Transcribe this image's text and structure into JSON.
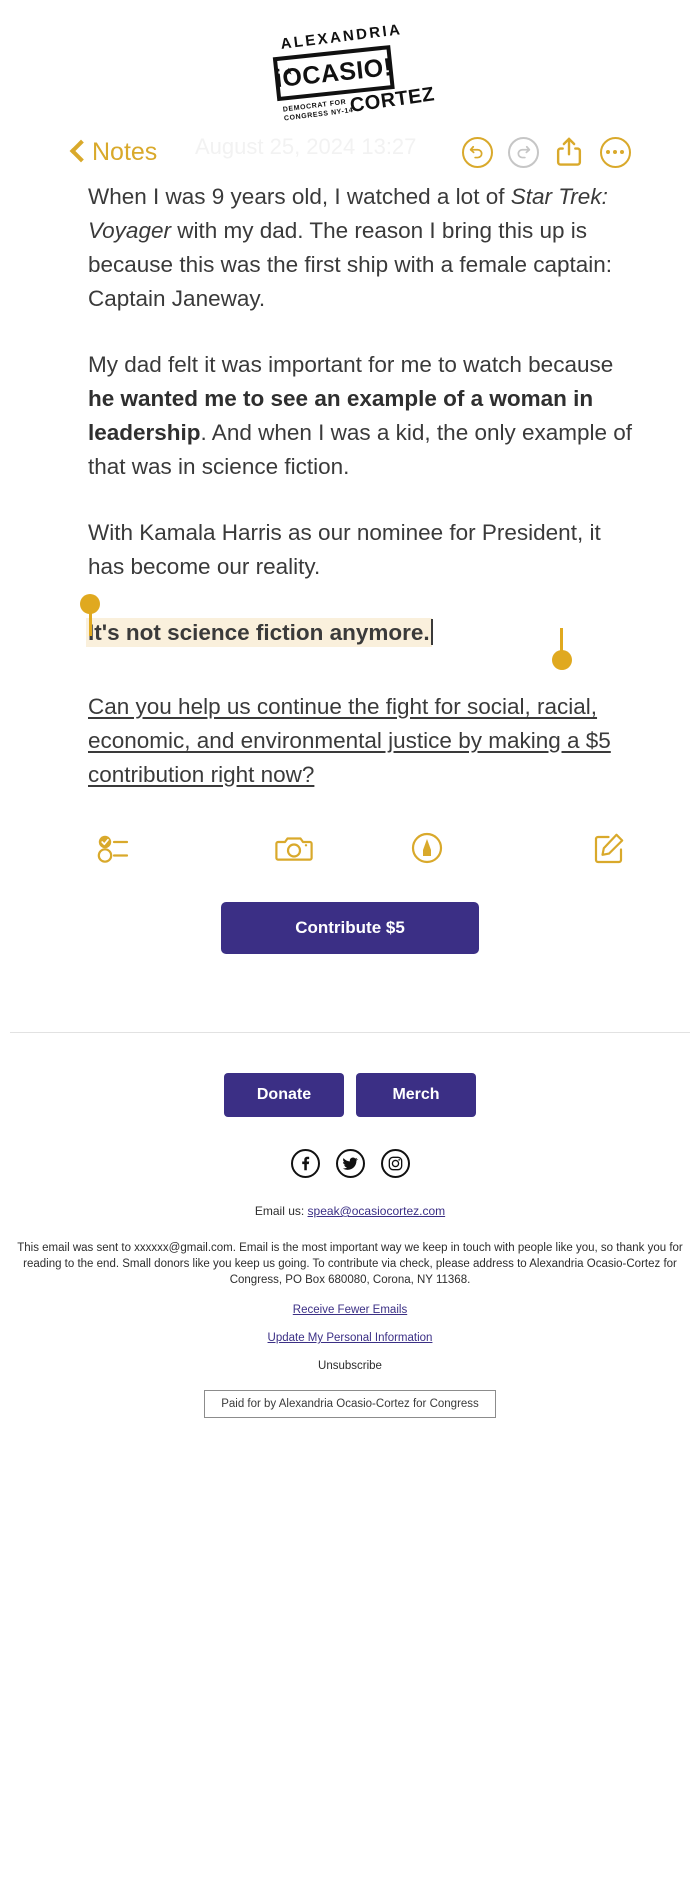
{
  "logo": {
    "line_top": "ALEXANDRIA",
    "main": "iOCASIO!",
    "sub_line1": "DEMOCRAT FOR",
    "sub_line2": "CONGRESS NY-14",
    "last_name": "CORTEZ",
    "star": "★"
  },
  "toolbar": {
    "back_label": "Notes",
    "ghost_date": "August 25, 2024 13:27",
    "undo_icon": "undo-icon",
    "redo_icon": "redo-icon",
    "share_icon": "share-icon",
    "more_icon": "more-options-icon",
    "accent_color": "#d9a92b",
    "disabled_color": "#c6c6c6"
  },
  "note": {
    "paragraphs": [
      {
        "id": "p1",
        "segments": [
          {
            "text": "When I was 9 years old, I watched a lot of ",
            "style": "normal"
          },
          {
            "text": "Star Trek: Voyager",
            "style": "italic"
          },
          {
            "text": " with my dad. The reason I bring this up is because this was the first ship with a female captain: Captain Janeway.",
            "style": "normal"
          }
        ]
      },
      {
        "id": "p2",
        "segments": [
          {
            "text": "My dad felt it was important for me to watch because ",
            "style": "normal"
          },
          {
            "text": "he wanted me to see an example of a woman in leadership",
            "style": "bold"
          },
          {
            "text": ". And when I was a kid, the only example of that was in science fiction.",
            "style": "normal"
          }
        ]
      },
      {
        "id": "p3",
        "segments": [
          {
            "text": "With Kamala Harris as our nominee for President, it has become our reality.",
            "style": "normal"
          }
        ]
      }
    ],
    "selected_text": "It's not science fiction anymore.",
    "selection_highlight_color": "#faf0dc",
    "selection_handle_color": "#e0a91f",
    "link_text": "Can you help us continue the fight for social, racial, economic, and environmental justice by making a $5 contribution right now?"
  },
  "note_iconbar": {
    "items": [
      {
        "name": "checklist-icon",
        "label": "Checklist"
      },
      {
        "name": "camera-icon",
        "label": "Camera"
      },
      {
        "name": "markup-pen-icon",
        "label": "Markup"
      },
      {
        "name": "compose-icon",
        "label": "Compose"
      }
    ],
    "color": "#d9a92b"
  },
  "cta": {
    "contribute_label": "Contribute $5",
    "button_color": "#3b2f85"
  },
  "footer": {
    "donate_label": "Donate",
    "merch_label": "Merch",
    "socials": [
      {
        "name": "facebook-icon",
        "glyph": "f"
      },
      {
        "name": "twitter-icon",
        "glyph": "t"
      },
      {
        "name": "instagram-icon",
        "glyph": "i"
      }
    ],
    "email_prefix": "Email us: ",
    "email_address": "speak@ocasiocortez.com",
    "legal_text": "This email was sent to xxxxxx@gmail.com. Email is the most important way we keep in touch with people like you, so thank you for reading to the end. Small donors like you keep us going. To contribute via check, please address to Alexandria Ocasio-Cortez for Congress, PO Box 680080, Corona, NY 11368.",
    "receive_fewer": "Receive Fewer Emails",
    "update_info": "Update My Personal Information",
    "unsubscribe": "Unsubscribe",
    "paid_for": "Paid for by Alexandria Ocasio-Cortez for Congress"
  }
}
